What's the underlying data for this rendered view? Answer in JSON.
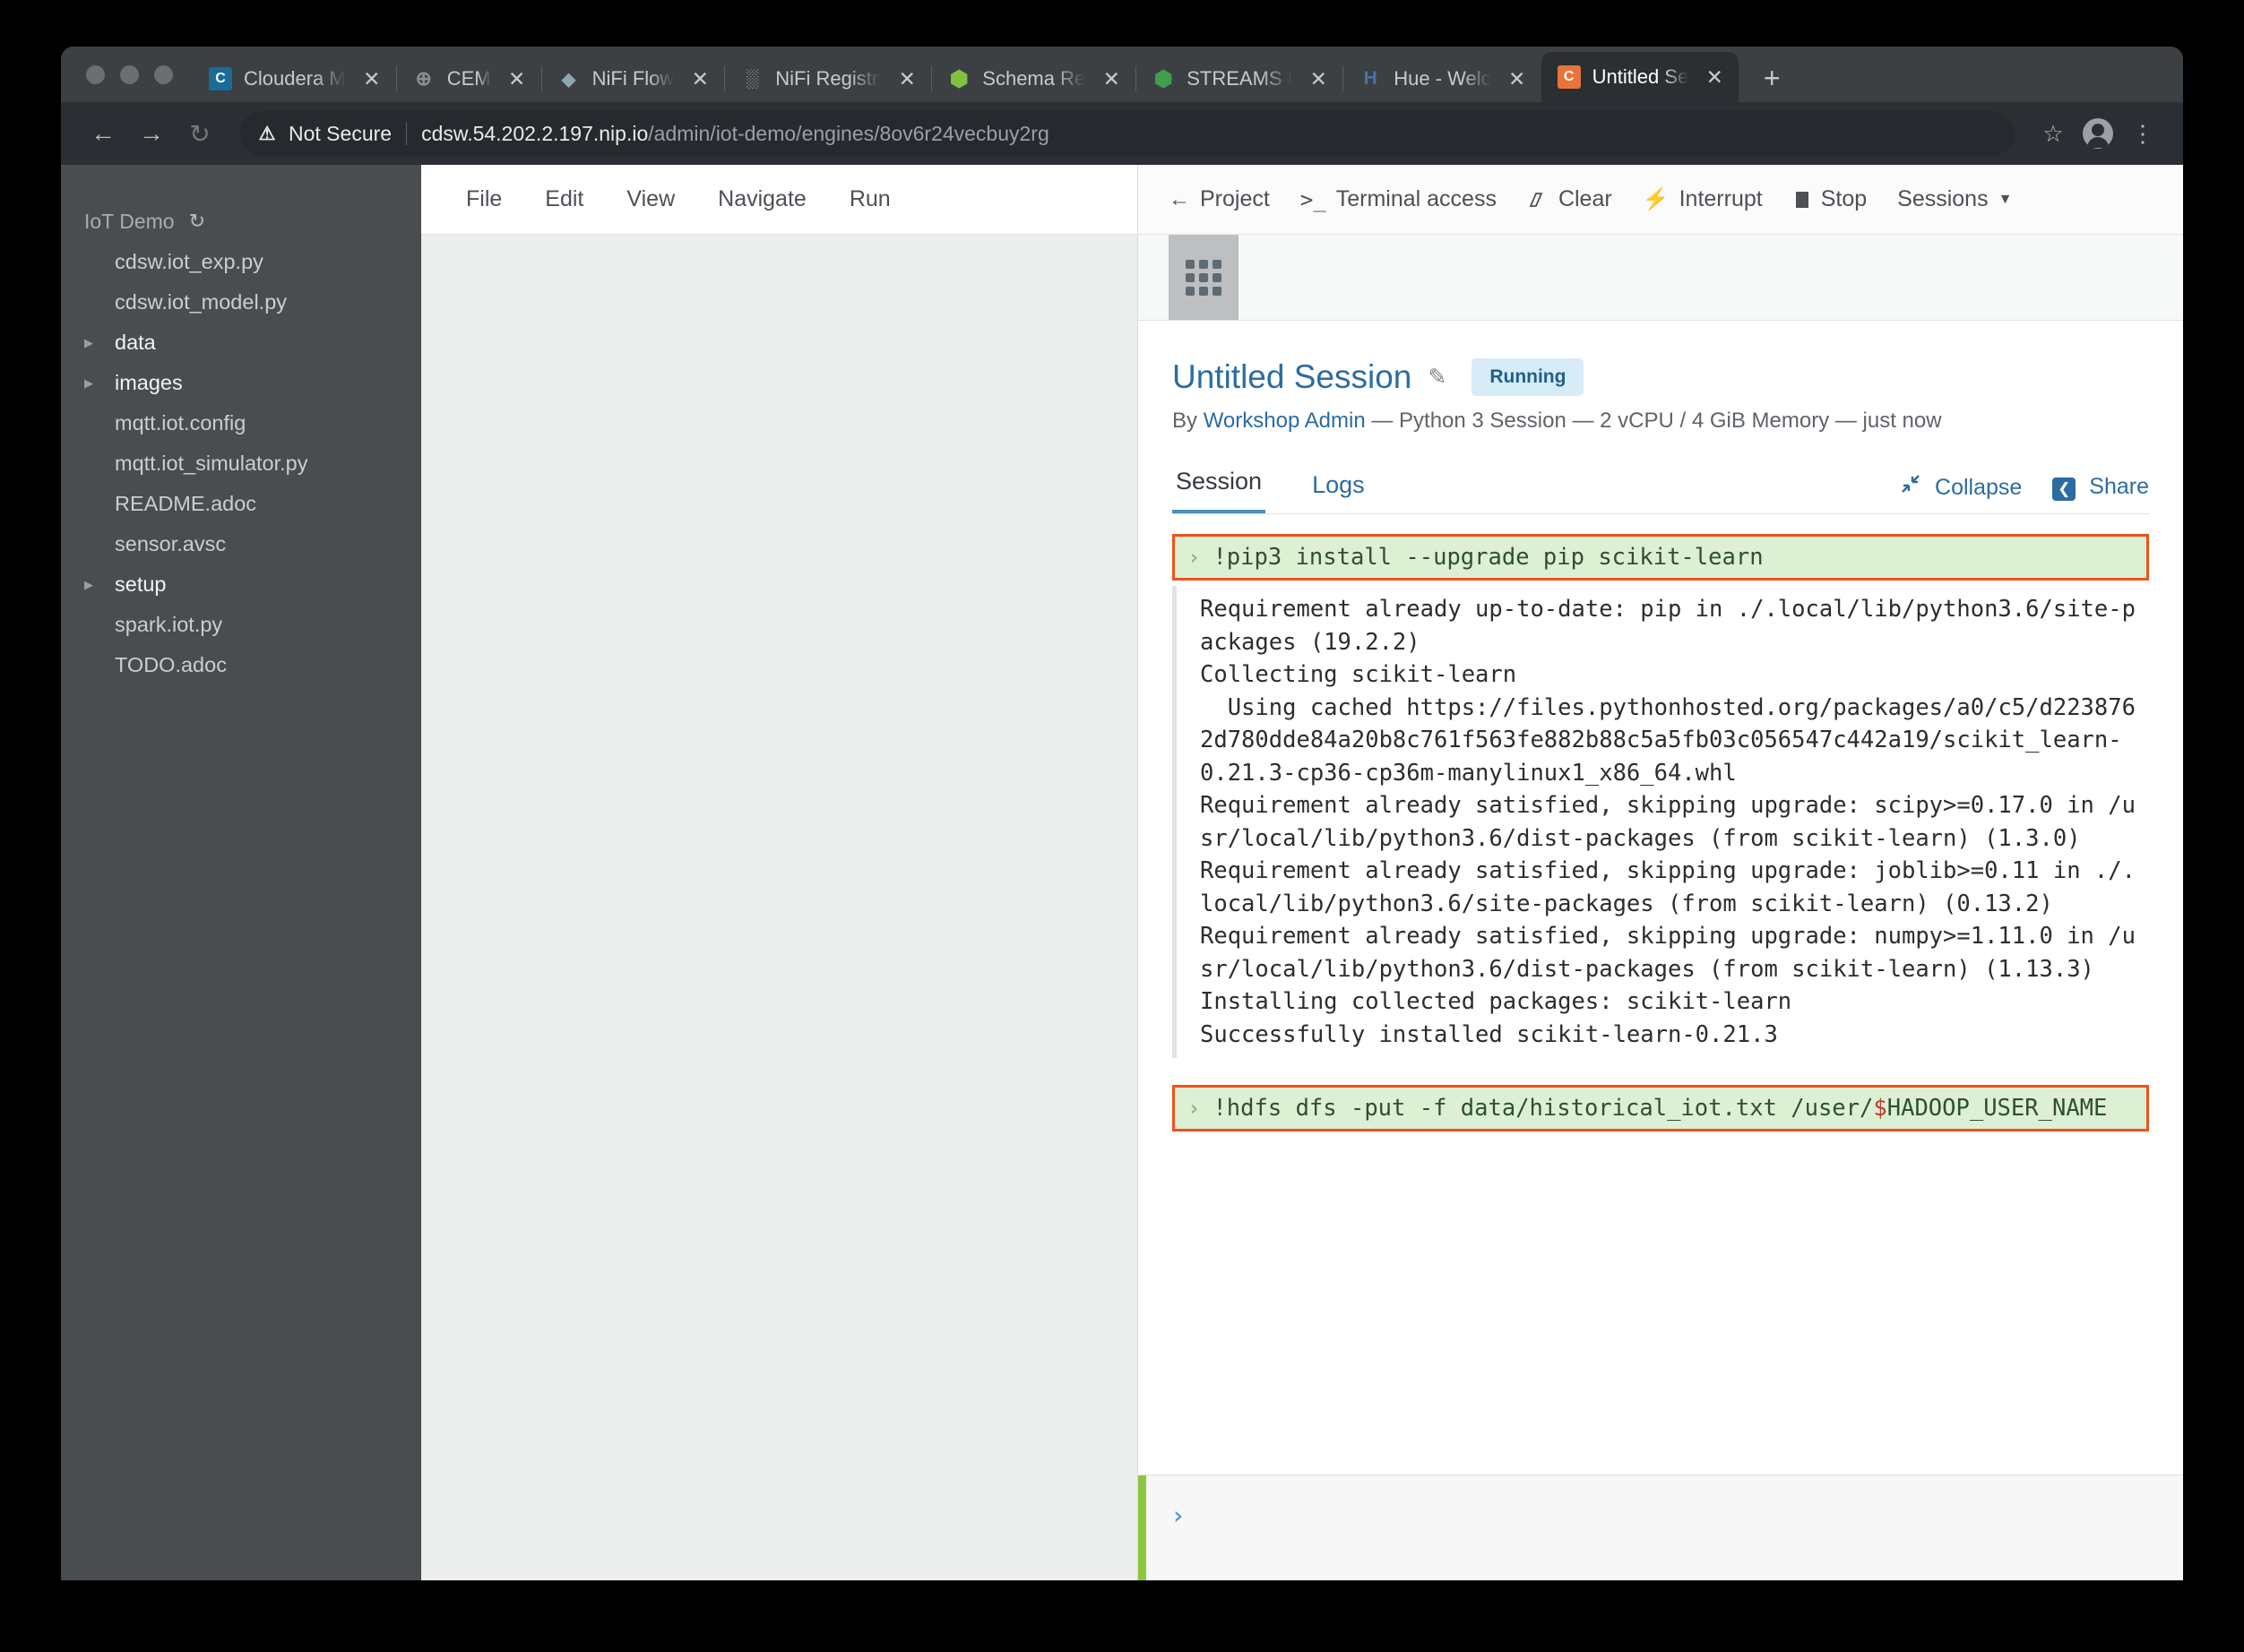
{
  "browser": {
    "tabs": [
      {
        "title": "Cloudera M",
        "favicon": "cloudera-icon",
        "fav_bg": "#1a6c97",
        "fav_glyph": "C",
        "active": false
      },
      {
        "title": "CEM",
        "favicon": "globe-icon",
        "fav_bg": "transparent",
        "fav_glyph": "⊕",
        "active": false
      },
      {
        "title": "NiFi Flow",
        "favicon": "nifi-drop-icon",
        "fav_bg": "transparent",
        "fav_glyph": "◆",
        "active": false
      },
      {
        "title": "NiFi Registry",
        "favicon": "nifi-registry-icon",
        "fav_bg": "transparent",
        "fav_glyph": "░",
        "active": false
      },
      {
        "title": "Schema Re",
        "favicon": "schema-registry-icon",
        "fav_bg": "transparent",
        "fav_glyph": "⬢",
        "active": false
      },
      {
        "title": "STREAMS M",
        "favicon": "streams-messaging-icon",
        "fav_bg": "transparent",
        "fav_glyph": "⬢",
        "active": false
      },
      {
        "title": "Hue - Welc",
        "favicon": "hue-icon",
        "fav_bg": "transparent",
        "fav_glyph": "H",
        "active": false
      },
      {
        "title": "Untitled Se",
        "favicon": "cdsw-icon",
        "fav_bg": "#e8743b",
        "fav_glyph": "C",
        "active": true
      }
    ],
    "new_tab_label": "+",
    "close_label": "✕",
    "back_label": "←",
    "forward_label": "→",
    "reload_label": "↻",
    "security_label": "Not Secure",
    "url_host": "cdsw.54.202.2.197.nip.io",
    "url_path": "/admin/iot-demo/engines/8ov6r24vecbuy2rg",
    "bookmark_label": "☆",
    "menu_label": "⋮"
  },
  "sidebar": {
    "project_name": "IoT Demo",
    "refresh_icon": "refresh-icon",
    "items": [
      {
        "label": "cdsw.iot_exp.py",
        "type": "file"
      },
      {
        "label": "cdsw.iot_model.py",
        "type": "file"
      },
      {
        "label": "data",
        "type": "dir"
      },
      {
        "label": "images",
        "type": "dir"
      },
      {
        "label": "mqtt.iot.config",
        "type": "file"
      },
      {
        "label": "mqtt.iot_simulator.py",
        "type": "file"
      },
      {
        "label": "README.adoc",
        "type": "file"
      },
      {
        "label": "sensor.avsc",
        "type": "file"
      },
      {
        "label": "setup",
        "type": "dir"
      },
      {
        "label": "spark.iot.py",
        "type": "file"
      },
      {
        "label": "TODO.adoc",
        "type": "file"
      }
    ]
  },
  "editor": {
    "menu": [
      "File",
      "Edit",
      "View",
      "Navigate",
      "Run"
    ]
  },
  "console": {
    "toolbar": [
      {
        "label": "Project",
        "icon": "back-arrow-icon"
      },
      {
        "label": "Terminal access",
        "icon": "terminal-icon"
      },
      {
        "label": "Clear",
        "icon": "eraser-icon"
      },
      {
        "label": "Interrupt",
        "icon": "bolt-icon"
      },
      {
        "label": "Stop",
        "icon": "stop-square-icon"
      },
      {
        "label": "Sessions",
        "icon": "chevron-down-icon"
      }
    ],
    "grid_icon": "grid-apps-icon",
    "session_title": "Untitled Session",
    "edit_icon": "edit-pencil-icon",
    "status_badge": "Running",
    "byline_prefix": "By",
    "author": "Workshop Admin",
    "byline_details": "— Python 3 Session — 2 vCPU / 4 GiB Memory — just now",
    "tabs": [
      {
        "label": "Session",
        "selected": true
      },
      {
        "label": "Logs",
        "selected": false
      }
    ],
    "collapse_label": "Collapse",
    "collapse_icon": "collapse-arrows-icon",
    "share_label": "Share",
    "share_icon": "share-icon",
    "cells": [
      {
        "type": "input",
        "highlighted": true,
        "prompt": "›",
        "code_before": "!pip3 install --upgrade pip scikit-learn",
        "code_dollar": "",
        "code_after": ""
      },
      {
        "type": "output",
        "text": "Requirement already up-to-date: pip in ./.local/lib/python3.6/site-p\nackages (19.2.2)\nCollecting scikit-learn\n  Using cached https://files.pythonhosted.org/packages/a0/c5/d223876\n2d780dde84a20b8c761f563fe882b88c5a5fb03c056547c442a19/scikit_learn-\n0.21.3-cp36-cp36m-manylinux1_x86_64.whl\nRequirement already satisfied, skipping upgrade: scipy>=0.17.0 in /u\nsr/local/lib/python3.6/dist-packages (from scikit-learn) (1.3.0)\nRequirement already satisfied, skipping upgrade: joblib>=0.11 in ./.\nlocal/lib/python3.6/site-packages (from scikit-learn) (0.13.2)\nRequirement already satisfied, skipping upgrade: numpy>=1.11.0 in /u\nsr/local/lib/python3.6/dist-packages (from scikit-learn) (1.13.3)\nInstalling collected packages: scikit-learn\nSuccessfully installed scikit-learn-0.21.3"
      },
      {
        "type": "input",
        "highlighted": true,
        "prompt": "›",
        "code_before": "!hdfs dfs -put -f data/historical_iot.txt /user/",
        "code_dollar": "$",
        "code_after": "HADOOP_USER_NAME"
      }
    ],
    "prompt_chevron": "›"
  },
  "colors": {
    "accent_blue": "#2b6ca3",
    "highlight_border": "#f2511b",
    "cell_bg": "#ddf0d3",
    "prompt_bar_green": "#8dc63f",
    "badge_bg": "#d6ecf7"
  }
}
